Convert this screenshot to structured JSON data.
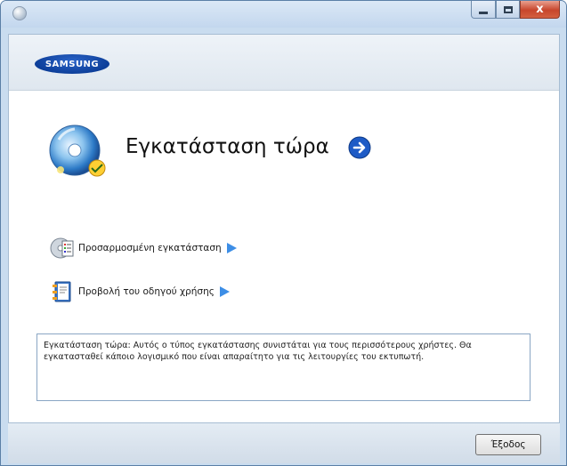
{
  "window": {
    "buttons": {
      "close_glyph": "x"
    }
  },
  "header": {
    "logo_text": "SAMSUNG"
  },
  "install_now": {
    "title": "Εγκατάσταση τώρα"
  },
  "options": [
    {
      "label": "Προσαρμοσμένη εγκατάσταση",
      "icon": "custom-install-icon"
    },
    {
      "label": "Προβολή του οδηγού χρήσης",
      "icon": "user-guide-icon"
    }
  ],
  "description": {
    "text": "Εγκατάσταση τώρα: Αυτός ο τύπος εγκατάστασης συνιστάται για τους περισσότερους χρήστες. Θα εγκατασταθεί κάποιο λογισμικό που είναι απαραίτητο για τις λειτουργίες του εκτυπωτή."
  },
  "footer": {
    "exit_label": "Έξοδος"
  },
  "colors": {
    "accent_blue": "#1e5bc6",
    "close_red": "#c7462c",
    "title_bar": "#c9dcef"
  }
}
